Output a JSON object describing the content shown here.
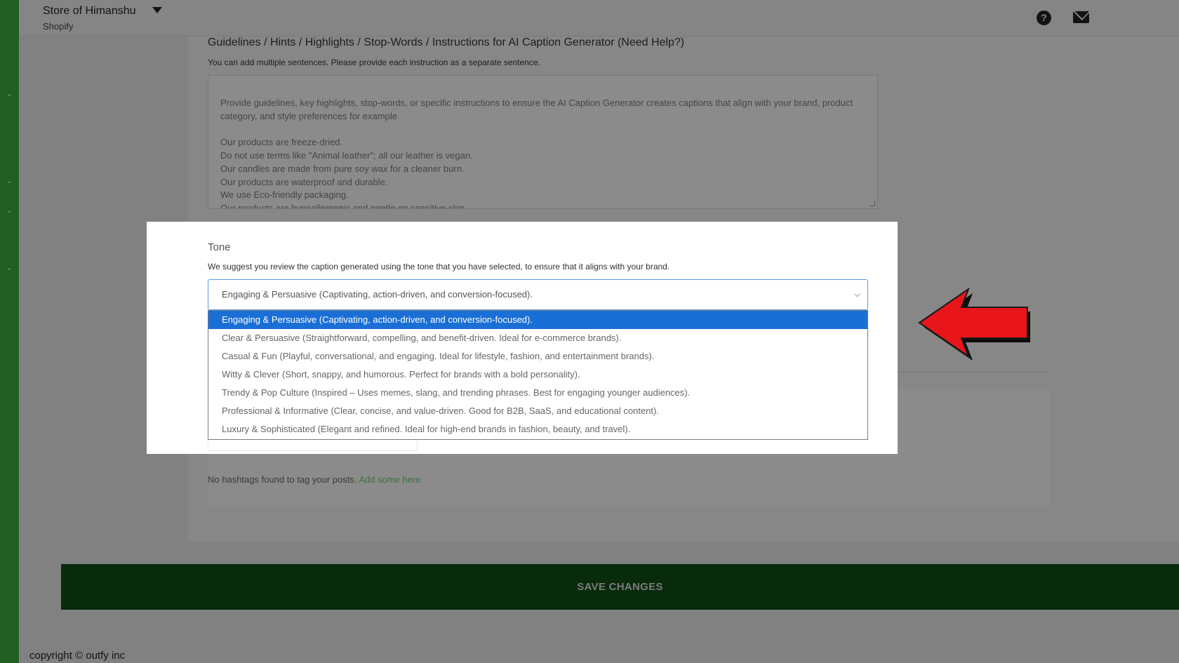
{
  "header": {
    "store_name": "Store of Himanshu",
    "platform": "Shopify",
    "help_icon": "help-circle-icon",
    "mail_icon": "mail-icon"
  },
  "guidelines": {
    "title": "Guidelines / Hints / Highlights / Stop-Words / Instructions for AI Caption Generator (Need Help?)",
    "subtitle": "You can add multiple sentences. Please provide each instruction as a separate sentence.",
    "placeholder": "Provide guidelines, key highlights, stop-words, or specific instructions to ensure the AI Caption Generator creates captions that align with your brand, product category, and style preferences for example\n\nOur products are freeze-dried.\nDo not use terms like \"Animal leather\"; all our leather is vegan.\nOur candles are made from pure soy wax for a cleaner burn.\nOur products are waterproof and durable.\nWe use Eco-friendly packaging.\nOur products are hypoallergenic and gentle on sensitive skin."
  },
  "tone": {
    "label": "Tone",
    "hint": "We suggest you review the caption generated using the tone that you have selected, to ensure that it aligns with your brand.",
    "selected": "Engaging & Persuasive (Captivating, action-driven, and conversion-focused).",
    "options": [
      "Engaging & Persuasive (Captivating, action-driven, and conversion-focused).",
      "Clear & Persuasive (Straightforward, compelling, and benefit-driven. Ideal for e-commerce brands).",
      "Casual & Fun (Playful, conversational, and engaging. Ideal for lifestyle, fashion, and entertainment brands).",
      "Witty & Clever (Short, snappy, and humorous. Perfect for brands with a bold personality).",
      "Trendy & Pop Culture (Inspired – Uses memes, slang, and trending phrases. Best for engaging younger audiences).",
      "Professional & Informative (Clear, concise, and value-driven. Good for B2B, SaaS, and educational content).",
      "Luxury & Sophisticated (Elegant and refined. Ideal for high-end brands in fashion, beauty, and travel)."
    ]
  },
  "hashtags": {
    "empty_text": "No hashtags found to tag your posts.",
    "add_link": "Add some here"
  },
  "actions": {
    "save_label": "SAVE CHANGES"
  },
  "footer": {
    "copyright": "copyright © outfy inc"
  },
  "colors": {
    "sidebar": "#39a33b",
    "save_button": "#0f4a14",
    "option_selected": "#1a6fd6",
    "arrow": "#e8151b"
  }
}
